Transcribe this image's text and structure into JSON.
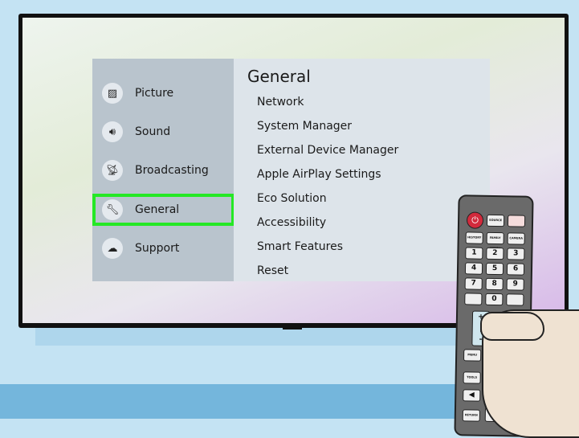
{
  "sidebar": {
    "items": [
      {
        "label": "Picture",
        "icon": "picture-icon",
        "selected": false
      },
      {
        "label": "Sound",
        "icon": "speaker-icon",
        "selected": false
      },
      {
        "label": "Broadcasting",
        "icon": "satellite-dish-icon",
        "selected": false
      },
      {
        "label": "General",
        "icon": "wrench-icon",
        "selected": true
      },
      {
        "label": "Support",
        "icon": "cloud-icon",
        "selected": false
      }
    ]
  },
  "main": {
    "title": "General",
    "items": [
      "Network",
      "System Manager",
      "External Device Manager",
      "Apple AirPlay Settings",
      "Eco Solution",
      "Accessibility",
      "Smart Features",
      "Reset"
    ]
  },
  "remote": {
    "buttons": {
      "source": "SOURCE",
      "history": "HISTORY",
      "family_story": "FAMILY STORY",
      "camera": "CAMERA",
      "menu": "MENU",
      "guide": "GUIDE",
      "tools": "TOOLS",
      "info": "INFO",
      "return": "RETURN",
      "exit": "EXIT"
    },
    "digits": [
      "1",
      "2",
      "3",
      "4",
      "5",
      "6",
      "7",
      "8",
      "9",
      "0"
    ]
  },
  "colors": {
    "highlight": "#25e825",
    "power": "#d22a3c"
  }
}
